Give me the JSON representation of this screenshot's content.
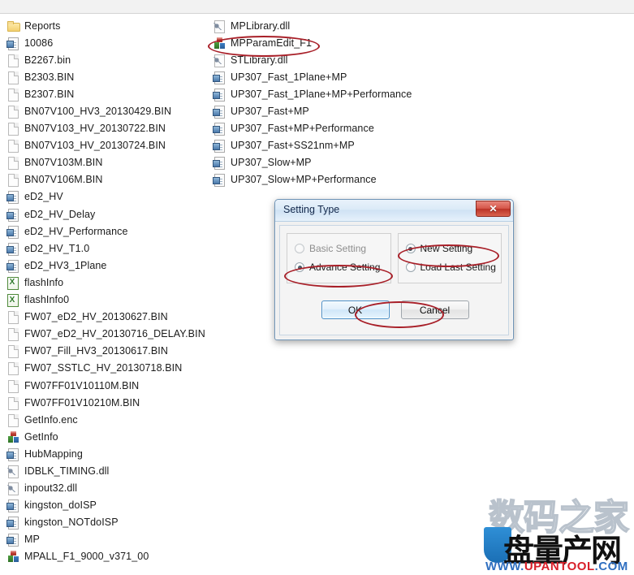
{
  "window": {
    "background_color": "#ffffff",
    "top_strip_color": "#f2f2f2"
  },
  "file_list": {
    "left_column": [
      {
        "name": "Reports",
        "icon": "folder-icon"
      },
      {
        "name": "10086",
        "icon": "config-document-icon"
      },
      {
        "name": "B2267.bin",
        "icon": "blank-page-icon"
      },
      {
        "name": "B2303.BIN",
        "icon": "blank-page-icon"
      },
      {
        "name": "B2307.BIN",
        "icon": "blank-page-icon"
      },
      {
        "name": "BN07V100_HV3_20130429.BIN",
        "icon": "blank-page-icon"
      },
      {
        "name": "BN07V103_HV_20130722.BIN",
        "icon": "blank-page-icon"
      },
      {
        "name": "BN07V103_HV_20130724.BIN",
        "icon": "blank-page-icon"
      },
      {
        "name": "BN07V103M.BIN",
        "icon": "blank-page-icon"
      },
      {
        "name": "BN07V106M.BIN",
        "icon": "blank-page-icon"
      },
      {
        "name": "eD2_HV",
        "icon": "config-document-icon"
      },
      {
        "name": "eD2_HV_Delay",
        "icon": "config-document-icon"
      },
      {
        "name": "eD2_HV_Performance",
        "icon": "config-document-icon"
      },
      {
        "name": "eD2_HV_T1.0",
        "icon": "config-document-icon"
      },
      {
        "name": "eD2_HV3_1Plane",
        "icon": "config-document-icon"
      },
      {
        "name": "flashInfo",
        "icon": "excel-icon"
      },
      {
        "name": "flashInfo0",
        "icon": "excel-icon"
      },
      {
        "name": "FW07_eD2_HV_20130627.BIN",
        "icon": "blank-page-icon"
      },
      {
        "name": "FW07_eD2_HV_20130716_DELAY.BIN",
        "icon": "blank-page-icon"
      },
      {
        "name": "FW07_Fill_HV3_20130617.BIN",
        "icon": "blank-page-icon"
      },
      {
        "name": "FW07_SSTLC_HV_20130718.BIN",
        "icon": "blank-page-icon"
      },
      {
        "name": "FW07FF01V10110M.BIN",
        "icon": "blank-page-icon"
      },
      {
        "name": "FW07FF01V10210M.BIN",
        "icon": "blank-page-icon"
      },
      {
        "name": "GetInfo.enc",
        "icon": "blank-page-icon"
      },
      {
        "name": "GetInfo",
        "icon": "application-icon"
      },
      {
        "name": "HubMapping",
        "icon": "config-document-icon"
      },
      {
        "name": "IDBLK_TIMING.dll",
        "icon": "dll-icon"
      },
      {
        "name": "inpout32.dll",
        "icon": "dll-icon"
      },
      {
        "name": "kingston_doISP",
        "icon": "config-document-icon"
      },
      {
        "name": "kingston_NOTdoISP",
        "icon": "config-document-icon"
      },
      {
        "name": "MP",
        "icon": "config-document-icon"
      },
      {
        "name": "MPALL_F1_9000_v371_00",
        "icon": "application-icon"
      }
    ],
    "right_column": [
      {
        "name": "MPLibrary.dll",
        "icon": "dll-icon"
      },
      {
        "name": "MPParamEdit_F1",
        "icon": "application-icon"
      },
      {
        "name": "STLibrary.dll",
        "icon": "dll-icon"
      },
      {
        "name": "UP307_Fast_1Plane+MP",
        "icon": "config-document-icon"
      },
      {
        "name": "UP307_Fast_1Plane+MP+Performance",
        "icon": "config-document-icon"
      },
      {
        "name": "UP307_Fast+MP",
        "icon": "config-document-icon"
      },
      {
        "name": "UP307_Fast+MP+Performance",
        "icon": "config-document-icon"
      },
      {
        "name": "UP307_Fast+SS21nm+MP",
        "icon": "config-document-icon"
      },
      {
        "name": "UP307_Slow+MP",
        "icon": "config-document-icon"
      },
      {
        "name": "UP307_Slow+MP+Performance",
        "icon": "config-document-icon"
      }
    ]
  },
  "annotations": {
    "color": "#a81f28",
    "ellipses": [
      {
        "label": "mpparamedit-highlight"
      },
      {
        "label": "advance-setting-highlight"
      },
      {
        "label": "new-setting-highlight"
      },
      {
        "label": "ok-button-highlight"
      }
    ]
  },
  "dialog": {
    "title": "Setting Type",
    "close_label": "✕",
    "left_group": {
      "options": [
        {
          "label": "Basic Setting",
          "checked": false,
          "disabled": true
        },
        {
          "label": "Advance Setting",
          "checked": true,
          "disabled": false
        }
      ]
    },
    "right_group": {
      "options": [
        {
          "label": "New Setting",
          "checked": true,
          "disabled": false
        },
        {
          "label": "Load Last Setting",
          "checked": false,
          "disabled": false
        }
      ]
    },
    "buttons": {
      "ok": "OK",
      "cancel": "Cancel"
    }
  },
  "watermark": {
    "line1": "数码之家",
    "line2": "盘量产网",
    "url_prefix": "WWW.",
    "url_name": "UPANTOOL",
    "url_suffix": ".COM",
    "blue": "#2f6fc0",
    "red": "#d8202a"
  }
}
